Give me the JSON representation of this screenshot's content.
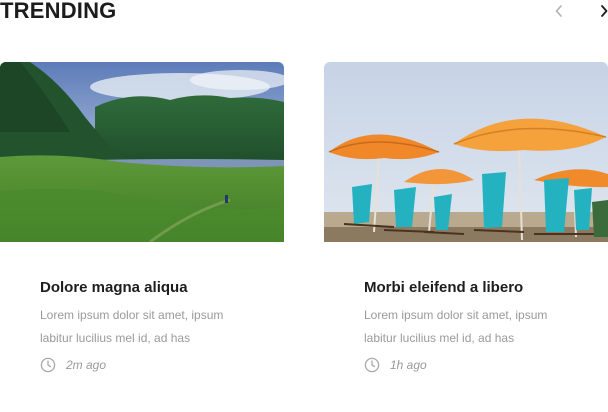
{
  "section": {
    "title": "TRENDING",
    "prev_icon": "chevron-left-icon",
    "next_icon": "chevron-right-icon"
  },
  "cards": [
    {
      "title": "Dolore magna aliqua",
      "excerpt": "Lorem ipsum dolor sit amet, ipsum labitur lucilius mel id, ad has",
      "time": "2m ago",
      "icon": "clock-icon"
    },
    {
      "title": "Morbi eleifend a libero",
      "excerpt": "Lorem ipsum dolor sit amet, ipsum labitur lucilius mel id, ad has",
      "time": "1h ago",
      "icon": "clock-icon"
    }
  ],
  "colors": {
    "title": "#1c1c1c",
    "muted": "#9a9a9a",
    "nav_disabled": "#b0b0b0",
    "nav_active": "#1c1c1c"
  }
}
